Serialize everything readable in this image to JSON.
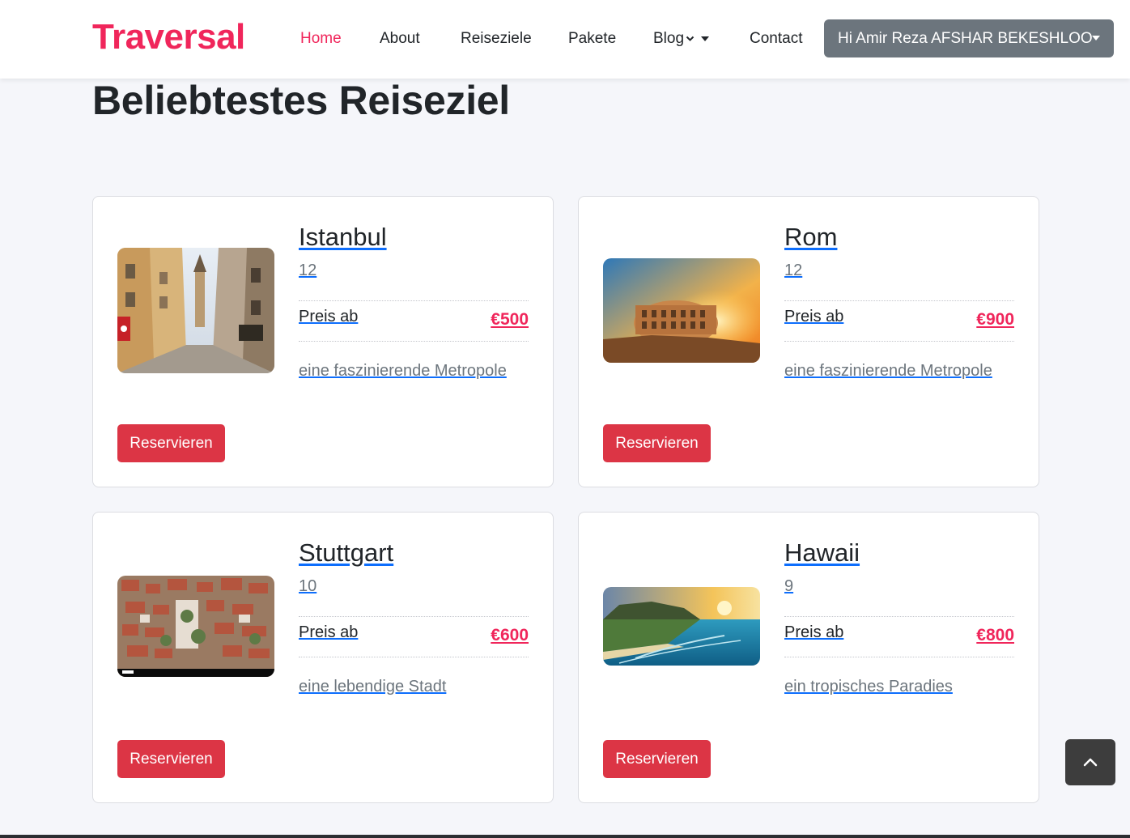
{
  "brand": {
    "name": "Traversal",
    "color": "#f0265b"
  },
  "nav": {
    "home": "Home",
    "about": "About",
    "destinations": "Reiseziele",
    "packages": "Pakete",
    "blog": "Blog",
    "contact": "Contact",
    "user_menu": "Hi Amir Reza AFSHAR BEKESHLOO"
  },
  "page": {
    "title": "Beliebtestes Reiseziel"
  },
  "cards": [
    {
      "title": "Istanbul",
      "count": "12",
      "price_label": "Preis ab",
      "price": "€500",
      "description": "eine faszinierende Metropole",
      "button": "Reservieren",
      "image": "istanbul-street-photo"
    },
    {
      "title": "Rom",
      "count": "12",
      "price_label": "Preis ab",
      "price": "€900",
      "description": "eine faszinierende Metropole",
      "button": "Reservieren",
      "image": "colosseum-sunset-photo"
    },
    {
      "title": "Stuttgart",
      "count": "10",
      "price_label": "Preis ab",
      "price": "€600",
      "description": "eine lebendige Stadt",
      "button": "Reservieren",
      "image": "stuttgart-rooftops-photo"
    },
    {
      "title": "Hawaii",
      "count": "9",
      "price_label": "Preis ab",
      "price": "€800",
      "description": "ein tropisches Paradies",
      "button": "Reservieren",
      "image": "hawaii-coast-photo"
    }
  ],
  "scroll_top": {
    "icon": "chevron-up-icon"
  },
  "colors": {
    "accent": "#f0265b",
    "button": "#dc3545",
    "user_button": "#6c757d",
    "link_underline": "#0d6efd"
  }
}
